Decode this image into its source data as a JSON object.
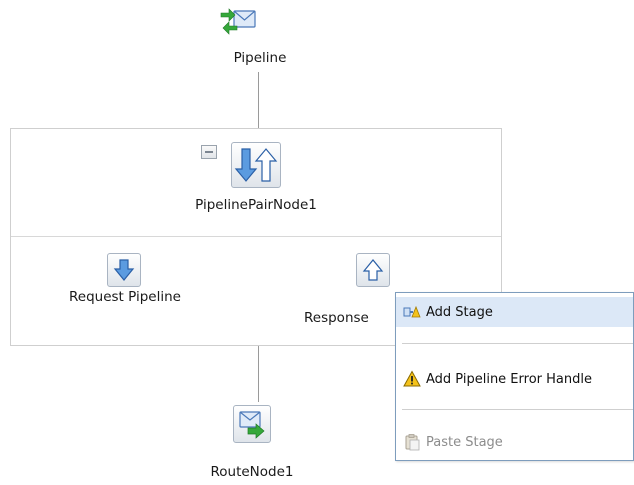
{
  "nodes": {
    "pipeline": {
      "label": "Pipeline"
    },
    "pair": {
      "label": "PipelinePairNode1"
    },
    "request": {
      "label": "Request Pipeline"
    },
    "response": {
      "label": "Response"
    },
    "route": {
      "label": "RouteNode1"
    }
  },
  "context_menu": {
    "items": [
      {
        "label": "Add Stage",
        "icon": "add-stage-icon",
        "state": "highlighted"
      },
      {
        "label": "Add Pipeline Error Handle",
        "icon": "warning-icon",
        "state": "enabled"
      },
      {
        "label": "Paste Stage",
        "icon": "paste-icon",
        "state": "disabled"
      }
    ]
  },
  "colors": {
    "highlight": "#dce8f7",
    "menu_border": "#7e9dbd",
    "arrow_blue": "#3f7fd1",
    "arrow_green": "#35a83a",
    "warning_yellow": "#f4c21b"
  }
}
